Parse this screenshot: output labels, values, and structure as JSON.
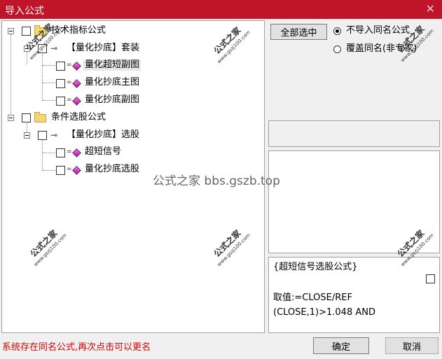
{
  "window": {
    "title": "导入公式",
    "close_glyph": "✕"
  },
  "tree": {
    "groups": [
      {
        "label": "技术指标公式",
        "set": {
          "label": "【量化抄底】套装",
          "items": [
            "量化超短副图",
            "量化抄底主图",
            "量化抄底副图"
          ]
        }
      },
      {
        "label": "条件选股公式",
        "set": {
          "label": "【量化抄底】选股",
          "items": [
            "超短信号",
            "量化抄底选股"
          ]
        }
      }
    ]
  },
  "right": {
    "select_all_label": "全部选中",
    "radio_options": [
      {
        "label": "不导入同名公式",
        "checked": true
      },
      {
        "label": "覆盖同名(非专家)",
        "checked": false
      }
    ]
  },
  "description": {
    "lines": [
      "{超短信号选股公式}",
      "取值:=CLOSE/REF",
      "(CLOSE,1)>1.048 AND"
    ]
  },
  "status_message": "系统存在同名公式,再次点击可以更名",
  "buttons": {
    "ok_label": "确定",
    "cancel_label": "取消"
  },
  "watermark": {
    "text": "公式之家",
    "url": "www.gszj100.com",
    "center_text": "公式之家 bbs.gszb.top"
  },
  "icons": [
    "close-icon",
    "folder-icon",
    "key-icon",
    "formula-gem-icon"
  ],
  "colors": {
    "titlebar": "#c0142b",
    "status_text": "#e00000",
    "gem": "#c020b0"
  }
}
